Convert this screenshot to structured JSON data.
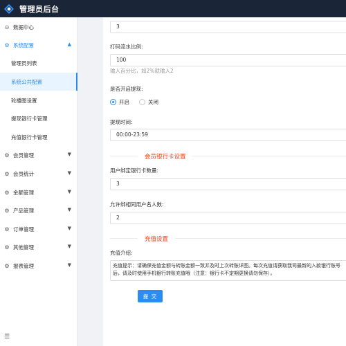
{
  "app": {
    "title": "管理员后台"
  },
  "sidebar": {
    "items": [
      {
        "label": "数据中心",
        "icon": "dashboard-icon"
      },
      {
        "label": "系统配置",
        "icon": "gear-icon",
        "expanded": true
      },
      {
        "label": "管理员列表"
      },
      {
        "label": "系统公共配置",
        "selected": true
      },
      {
        "label": "轮播图设置"
      },
      {
        "label": "提现银行卡管理"
      },
      {
        "label": "充值银行卡管理"
      },
      {
        "label": "会员管理",
        "icon": "gear-icon"
      },
      {
        "label": "会员统计",
        "icon": "gear-icon"
      },
      {
        "label": "金额管理",
        "icon": "gear-icon"
      },
      {
        "label": "产品管理",
        "icon": "gear-icon"
      },
      {
        "label": "订单管理",
        "icon": "gear-icon"
      },
      {
        "label": "其他管理",
        "icon": "gear-icon"
      },
      {
        "label": "报表管理",
        "icon": "gear-icon"
      }
    ]
  },
  "form": {
    "top_value": "3",
    "turnover_label": "打码流水比例:",
    "turnover_value": "100",
    "turnover_hint": "输入百分比，如2%就输入2",
    "withdraw_enabled_label": "是否开启提现:",
    "withdraw_on": "开启",
    "withdraw_off": "关闭",
    "withdraw_time_label": "提现时间:",
    "withdraw_time_value": "00:00-23:59",
    "bank_section_title": "会员银行卡设置",
    "bind_count_label": "用户绑定银行卡数量:",
    "bind_count_value": "3",
    "same_name_label": "允许绑相同用户名人数:",
    "same_name_value": "2",
    "recharge_section_title": "充值设置",
    "recharge_intro_label": "充值介绍:",
    "recharge_intro_value": "充值提示：请确保充值金额与转账金额一致并及时上次转账详图。每次充值请获取我司最新的入款银行账号后，请及时使用手机银行转账充值哦（注意：银行卡不定期更换请勿保存）。",
    "submit_label": "提 交"
  }
}
